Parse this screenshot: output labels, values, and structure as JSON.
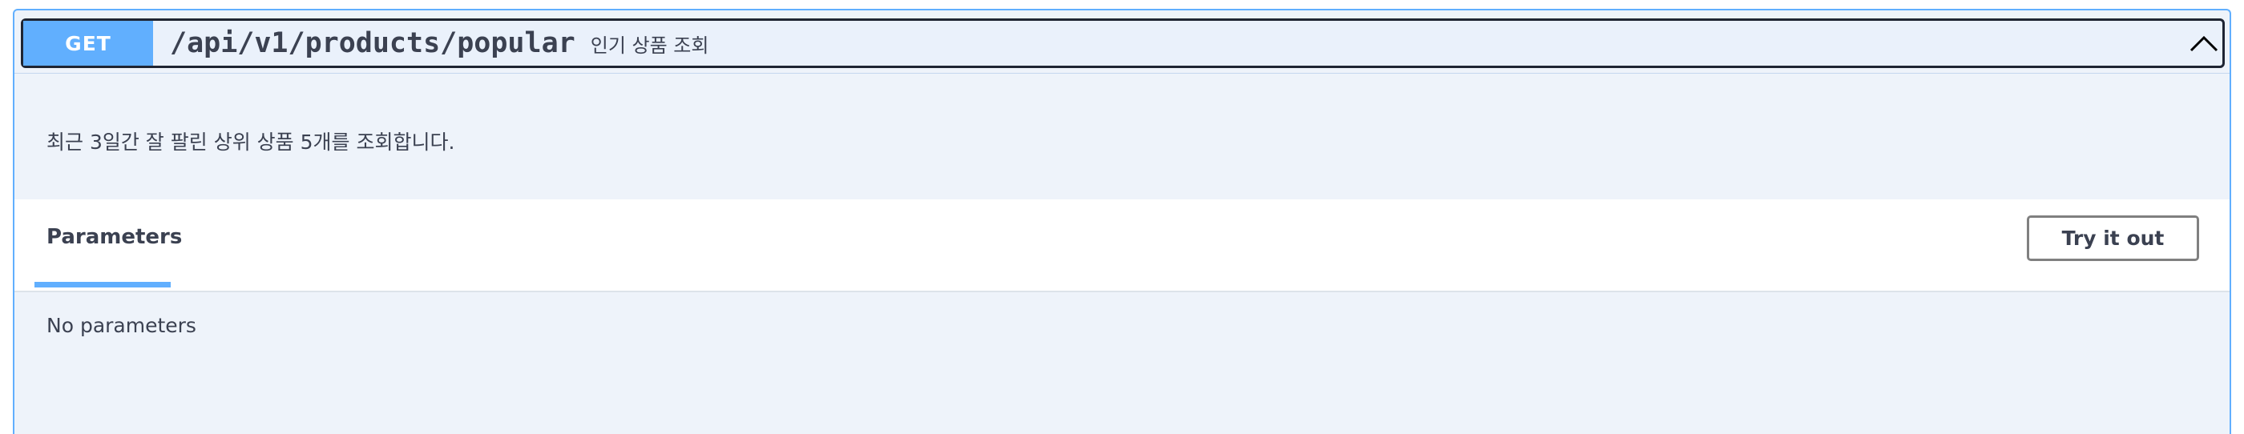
{
  "operation": {
    "method": "GET",
    "path": "/api/v1/products/popular",
    "summary": "인기 상품 조회",
    "description": "최근 3일간 잘 팔린 상위 상품 5개를 조회합니다.",
    "expanded": true,
    "chevron_icon": "chevron-up-icon"
  },
  "parameters": {
    "tab_label": "Parameters",
    "try_button_label": "Try it out",
    "empty_message": "No parameters"
  },
  "colors": {
    "method_get": "#61affe",
    "block_background": "#eef3fa",
    "text": "#3b4151"
  }
}
